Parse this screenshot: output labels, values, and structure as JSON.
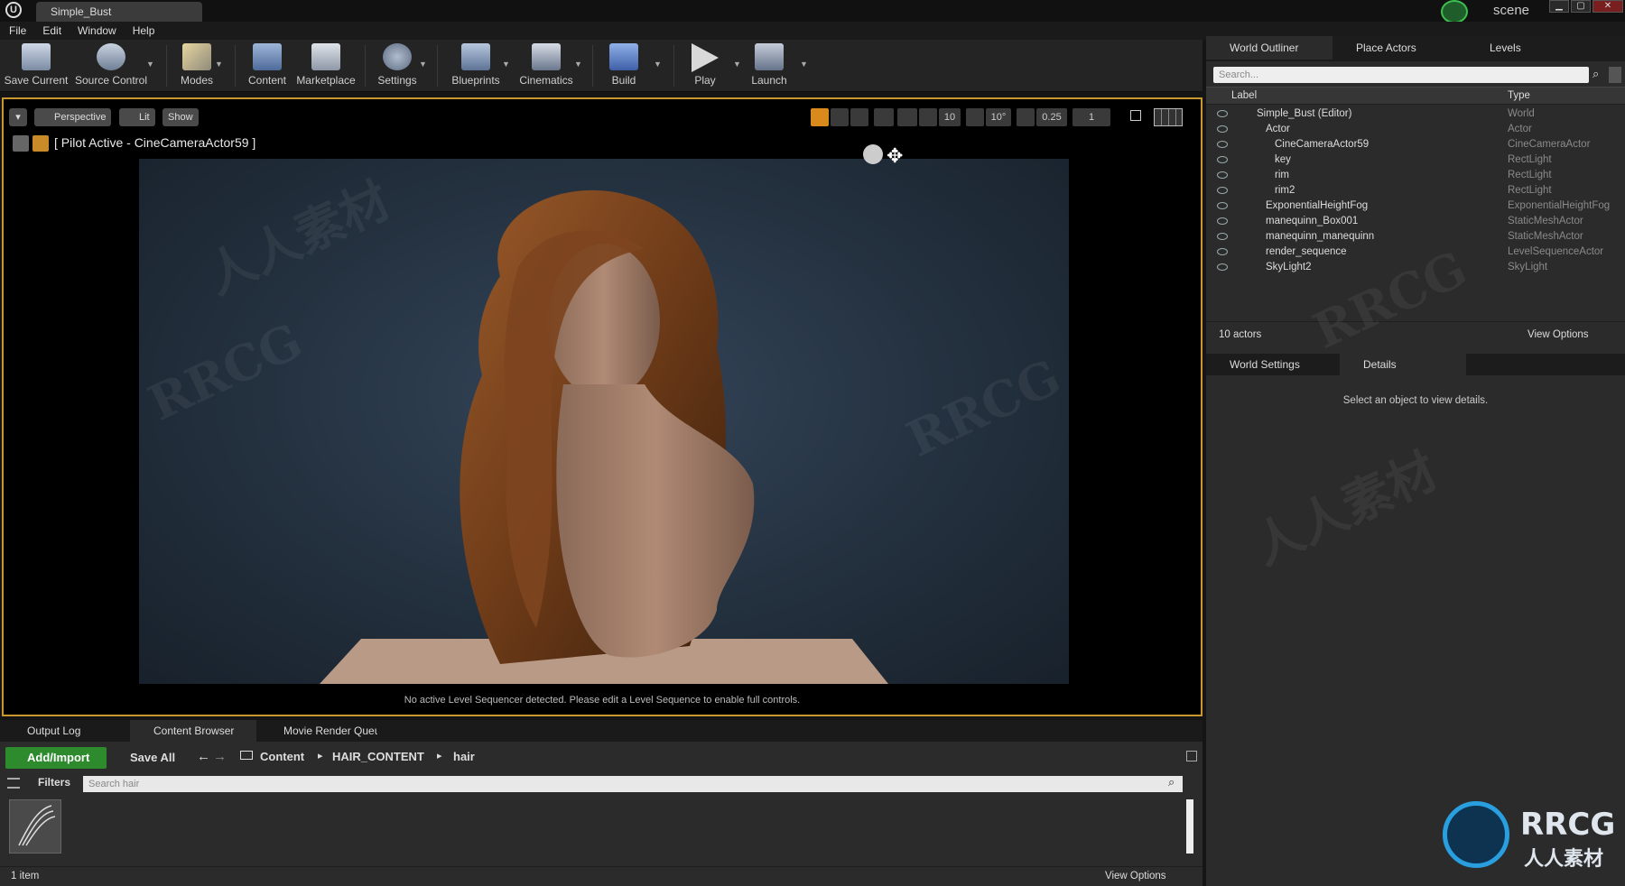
{
  "window": {
    "tab_title": "Simple_Bust",
    "scene_label": "scene",
    "minimize": "▁",
    "maximize": "▢",
    "close": "✕"
  },
  "menu": [
    "File",
    "Edit",
    "Window",
    "Help"
  ],
  "toolbar": [
    {
      "label": "Save Current",
      "icon": "save-icon"
    },
    {
      "label": "Source Control",
      "icon": "source-control-icon"
    },
    {
      "label": "Modes",
      "icon": "modes-icon"
    },
    {
      "label": "Content",
      "icon": "content-icon"
    },
    {
      "label": "Marketplace",
      "icon": "marketplace-icon"
    },
    {
      "label": "Settings",
      "icon": "settings-icon"
    },
    {
      "label": "Blueprints",
      "icon": "blueprints-icon"
    },
    {
      "label": "Cinematics",
      "icon": "cinematics-icon"
    },
    {
      "label": "Build",
      "icon": "build-icon"
    },
    {
      "label": "Play",
      "icon": "play-icon"
    },
    {
      "label": "Launch",
      "icon": "launch-icon"
    }
  ],
  "viewport": {
    "perspective": "Perspective",
    "lit": "Lit",
    "show": "Show",
    "pilot_label": "[ Pilot Active - CineCameraActor59 ]",
    "grid_snap": "10",
    "rotation_snap": "10°",
    "scale_snap": "0.25",
    "camera_speed": "1",
    "footer": "No active Level Sequencer detected. Please edit a Level Sequence to enable full controls."
  },
  "outliner": {
    "tabs": [
      "World Outliner",
      "Place Actors",
      "Levels"
    ],
    "search_placeholder": "Search...",
    "col_label": "Label",
    "col_type": "Type",
    "rows": [
      {
        "name": "Simple_Bust (Editor)",
        "type": "World"
      },
      {
        "name": "Actor",
        "type": "Actor"
      },
      {
        "name": "CineCameraActor59",
        "type": "CineCameraActor"
      },
      {
        "name": "key",
        "type": "RectLight"
      },
      {
        "name": "rim",
        "type": "RectLight"
      },
      {
        "name": "rim2",
        "type": "RectLight"
      },
      {
        "name": "ExponentialHeightFog",
        "type": "ExponentialHeightFog"
      },
      {
        "name": "manequinn_Box001",
        "type": "StaticMeshActor"
      },
      {
        "name": "manequinn_manequinn",
        "type": "StaticMeshActor"
      },
      {
        "name": "render_sequence",
        "type": "LevelSequenceActor"
      },
      {
        "name": "SkyLight2",
        "type": "SkyLight"
      }
    ],
    "actor_count": "10 actors",
    "view_options": "View Options"
  },
  "details": {
    "tabs": [
      "World Settings",
      "Details"
    ],
    "empty_message": "Select an object to view details."
  },
  "bottom_tabs": [
    "Output Log",
    "Content Browser",
    "Movie Render Queu"
  ],
  "content_browser": {
    "add_import": "Add/Import",
    "save_all": "Save All",
    "path": [
      "Content",
      "HAIR_CONTENT",
      "hair"
    ],
    "filters": "Filters",
    "search_placeholder": "Search hair",
    "item_count": "1 item",
    "view_options": "View Options"
  },
  "watermarks": [
    "RRCG",
    "人人素材"
  ],
  "logo": {
    "brand": "RRCG",
    "sub": "人人素材"
  },
  "colors": {
    "accent_green": "#2d8b2d",
    "viewport_border": "#c8982f"
  }
}
